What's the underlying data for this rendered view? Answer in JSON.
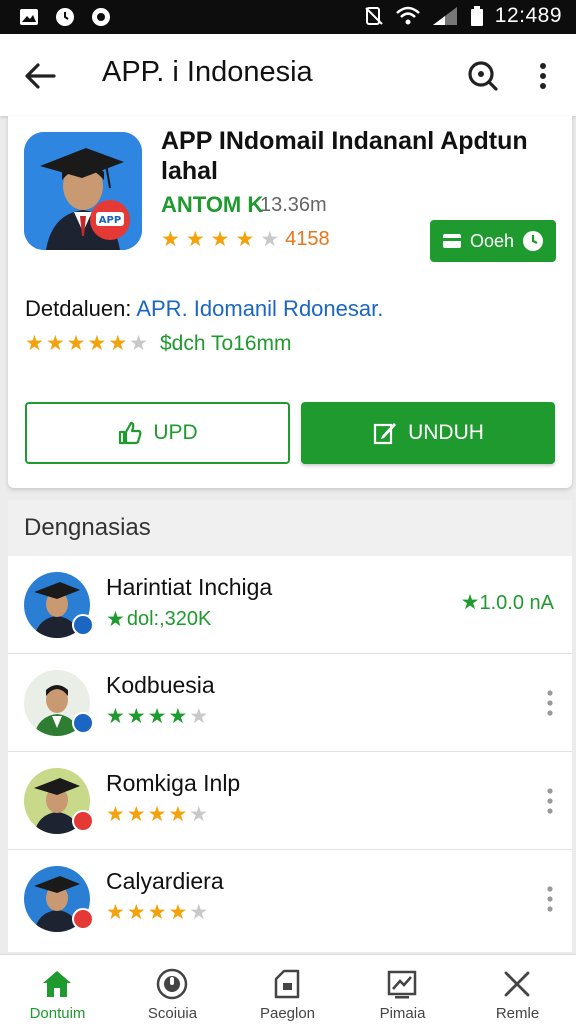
{
  "status_bar": {
    "time": "12:489"
  },
  "app_bar": {
    "title": "APP. i Indonesia"
  },
  "app": {
    "name": "APP INdomail Indananl Apdtun lahal",
    "developer": "ANTOM K",
    "size": "13.36m",
    "rating_text": "4158",
    "rating_stars": 4,
    "status_pill": "Ooeh",
    "detail_label": "Detdaluen:",
    "detail_link": "APR. Idomanil Rdonesar.",
    "detail_stars": 5,
    "detail_text": "$dch To16mm",
    "btn_outline": "UPD",
    "btn_primary": "UNDUH"
  },
  "section": {
    "title": "Dengnasias",
    "items": [
      {
        "name": "Harintiat Inchiga",
        "sub": "dol:,320K",
        "right": "1.0.0 nA"
      },
      {
        "name": "Kodbuesia",
        "stars": 4
      },
      {
        "name": "Romkiga Inlp",
        "stars": 4
      },
      {
        "name": "Calyardiera",
        "stars": 4
      }
    ]
  },
  "bottom_nav": [
    {
      "label": "Dontuim"
    },
    {
      "label": "Scoiuia"
    },
    {
      "label": "Paeglon"
    },
    {
      "label": "Pimaia"
    },
    {
      "label": "Remle"
    }
  ],
  "colors": {
    "accent": "#1e9a2e",
    "star": "#f4a20b",
    "link": "#1a66c2",
    "rating": "#e8771b"
  }
}
